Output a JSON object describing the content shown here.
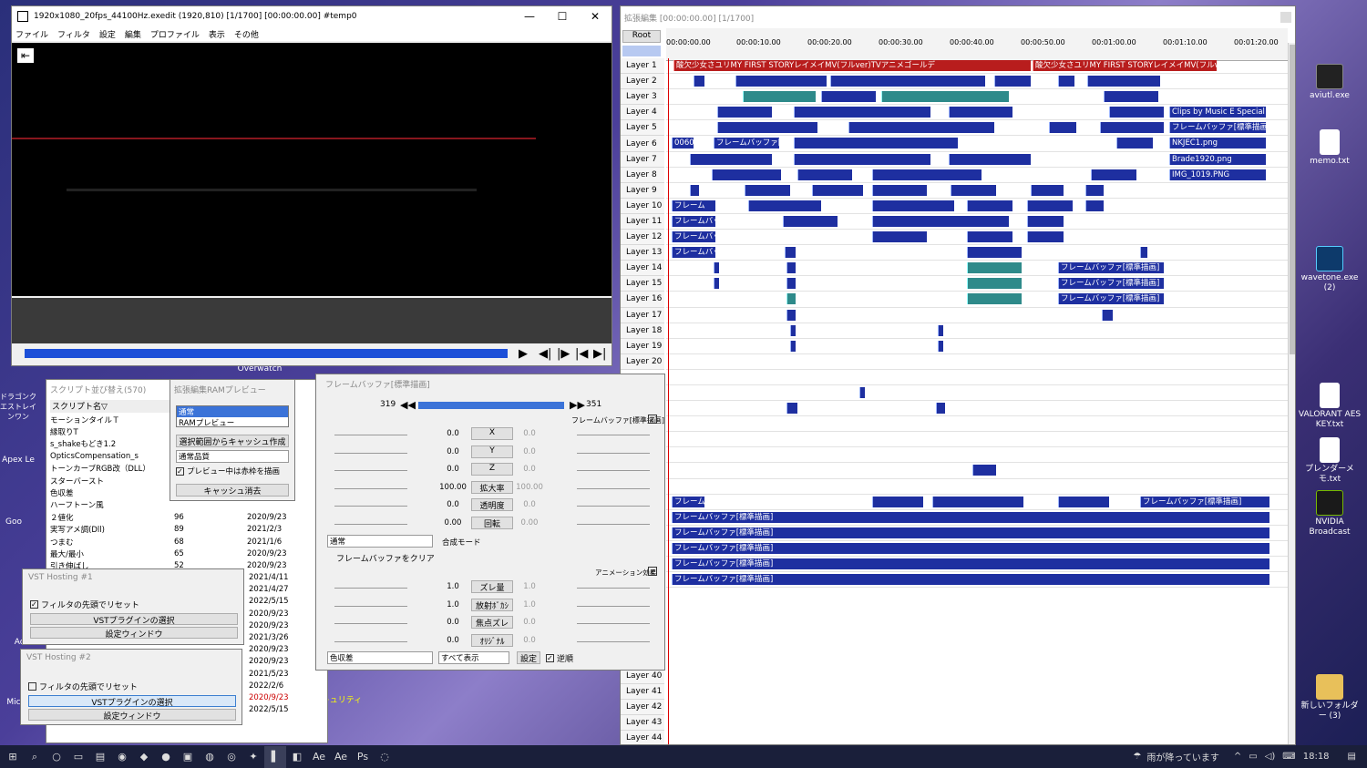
{
  "main_window": {
    "title": "1920x1080_20fps_44100Hz.exedit (1920,810)  [1/1700]  [00:00:00.00]  #temp0",
    "menu": [
      "ファイル",
      "フィルタ",
      "設定",
      "編集",
      "プロファイル",
      "表示",
      "その他"
    ]
  },
  "timeline": {
    "title": "拡張編集 [00:00:00.00] [1/1700]",
    "root_label": "Root",
    "ruler": [
      "00:00:00.00",
      "00:00:10.00",
      "00:00:20.00",
      "00:00:30.00",
      "00:00:40.00",
      "00:00:50.00",
      "00:01:00.00",
      "00:01:10.00",
      "00:01:20.00"
    ],
    "layers": [
      "Layer 1",
      "Layer 2",
      "Layer 3",
      "Layer 4",
      "Layer 5",
      "Layer 6",
      "Layer 7",
      "Layer 8",
      "Layer 9",
      "Layer 10",
      "Layer 11",
      "Layer 12",
      "Layer 13",
      "Layer 14",
      "Layer 15",
      "Layer 16",
      "Layer 17",
      "Layer 18",
      "Layer 19",
      "Layer 20"
    ],
    "bottom_layers": [
      "Layer 40",
      "Layer 41",
      "Layer 42",
      "Layer 43",
      "Layer 44"
    ],
    "clips": {
      "l1a": "酸欠少女さユリMY FIRST STORYレイメイMV(フルver)TVアニメゴールデ",
      "l1b": "酸欠少女さユリMY FIRST STORYレイメイMV(フルver)",
      "l4": "Clips by Music E Special",
      "l5": "フレームバッファ[標準描画]",
      "l6a": "0060",
      "l6b": "フレームバッファ[標",
      "l6c": "NKJEC1.png",
      "l7": "Brade1920.png",
      "l8": "IMG_1019.PNG",
      "buf": "フレームバッファ[標準描画]",
      "buf_short": "フレームバッファ",
      "buf_tiny": "フレーム"
    }
  },
  "script_panel": {
    "title": "スクリプト並び替え(570)",
    "header": "スクリプト名▽",
    "rows": [
      [
        "モーションタイルＴ",
        "",
        ""
      ],
      [
        "縁取りT",
        "",
        ""
      ],
      [
        "s_shakeもどき1.2",
        "",
        ""
      ],
      [
        "OpticsCompensation_s",
        "",
        ""
      ],
      [
        "トーンカーブRGB改（DLL）",
        "",
        ""
      ],
      [
        "スターバースト",
        "",
        ""
      ],
      [
        "色収差",
        "",
        ""
      ],
      [
        "ハーフトーン風",
        "",
        ""
      ],
      [
        "２値化",
        "96",
        "2020/9/23"
      ],
      [
        "実写アメ調(Dll)",
        "89",
        "2021/2/3"
      ],
      [
        "つまむ",
        "68",
        "2021/1/6"
      ],
      [
        "最大/最小",
        "65",
        "2020/9/23"
      ],
      [
        "引き伸ばし",
        "52",
        "2020/9/23"
      ]
    ],
    "dates_more": [
      "2021/4/11",
      "2021/4/27",
      "2022/5/15",
      "2020/9/23",
      "2020/9/23",
      "2021/3/26",
      "2020/9/23",
      "2020/9/23",
      "2021/5/23",
      "2022/2/6",
      "2020/9/23",
      "2022/5/15"
    ]
  },
  "ram_preview": {
    "title": "拡張編集RAMプレビュー",
    "opt1": "通常",
    "opt2": "RAMプレビュー",
    "btn_cache": "選択範囲からキャッシュ作成",
    "quality": "通常品質",
    "check_label": "プレビュー中は赤枠を描画",
    "btn_clear": "キャッシュ消去"
  },
  "vst1": {
    "title": "VST Hosting #1",
    "check": "フィルタの先頭でリセット",
    "btn_select": "VSTプラグインの選択",
    "btn_window": "設定ウィンドウ"
  },
  "vst2": {
    "title": "VST Hosting #2",
    "check": "フィルタの先頭でリセット",
    "btn_select": "VSTプラグインの選択",
    "btn_window": "設定ウィンドウ"
  },
  "object_panel": {
    "title": "フレームバッファ[標準描画]",
    "frame_start": "319",
    "frame_end": "351",
    "filter_label": "フレームバッファ[標準描画]",
    "params": [
      {
        "name": "X",
        "v1": "0.0",
        "v2": "0.0"
      },
      {
        "name": "Y",
        "v1": "0.0",
        "v2": "0.0"
      },
      {
        "name": "Z",
        "v1": "0.0",
        "v2": "0.0"
      },
      {
        "name": "拡大率",
        "v1": "100.00",
        "v2": "100.00"
      },
      {
        "name": "透明度",
        "v1": "0.0",
        "v2": "0.0"
      },
      {
        "name": "回転",
        "v1": "0.00",
        "v2": "0.00"
      }
    ],
    "blend_mode": "通常",
    "blend_label": "合成モード",
    "clear_label": "フレームバッファをクリア",
    "effect_label": "アニメーション効果",
    "params2": [
      {
        "name": "ズレ量",
        "v1": "1.0",
        "v2": "1.0"
      },
      {
        "name": "放射ﾎﾞｶｼ",
        "v1": "1.0",
        "v2": "1.0"
      },
      {
        "name": "焦点ズレ",
        "v1": "0.0",
        "v2": "0.0"
      },
      {
        "name": "ｵﾘｼﾞﾅﾙ",
        "v1": "0.0",
        "v2": "0.0"
      }
    ],
    "effect_select": "色収差",
    "show_select": "すべて表示",
    "settings_btn": "設定",
    "reverse_label": "逆順"
  },
  "desktop": {
    "icons": [
      "aviutl.exe",
      "memo.txt",
      "wavetone.exe (2)",
      "VALORANT AES KEY.txt",
      "プレンダーメモ.txt",
      "NVIDIA Broadcast",
      "新しいフォルダー (3)",
      "Overwatch",
      "ドラゴンクエストレインワン",
      "Apex Le",
      "Goo",
      "Mic",
      "Adobe",
      "キュリティ"
    ]
  },
  "taskbar": {
    "weather": "雨が降っています",
    "time": "18:18"
  }
}
